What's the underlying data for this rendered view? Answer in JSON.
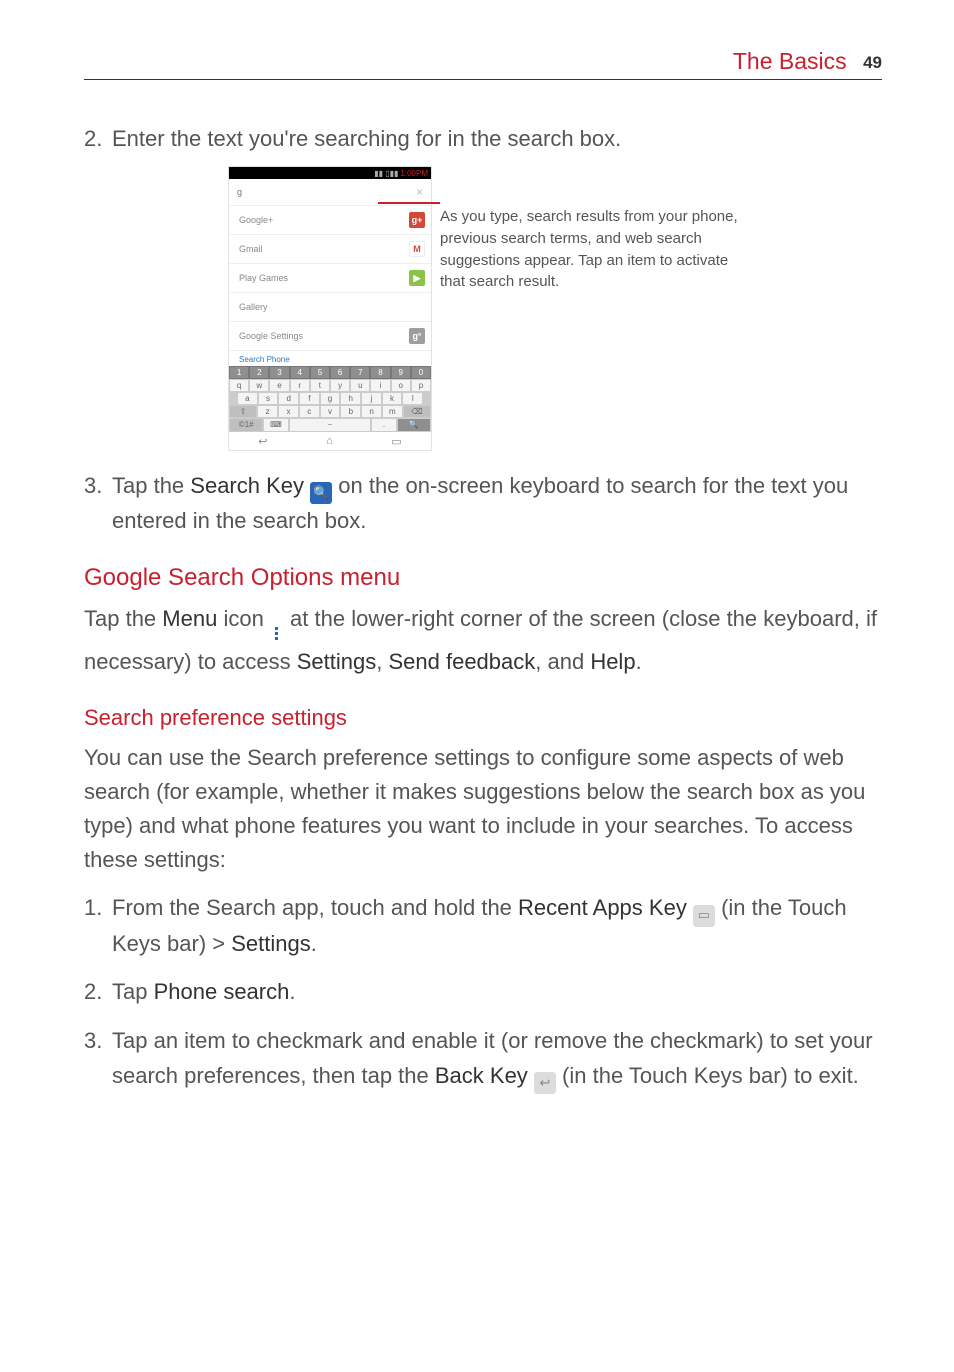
{
  "header": {
    "section": "The Basics",
    "page": "49"
  },
  "step2": {
    "num": "2.",
    "text": "Enter the text you're searching for in the search box."
  },
  "phone": {
    "status_time": "1:00PM",
    "search_value": "g",
    "suggestions": [
      {
        "label": "Google+",
        "icon": "g+"
      },
      {
        "label": "Gmail",
        "icon": "M"
      },
      {
        "label": "Play Games",
        "icon": "▶"
      },
      {
        "label": "Gallery",
        "icon": "◪"
      },
      {
        "label": "Google Settings",
        "icon": "g°"
      }
    ],
    "search_phone_label": "Search Phone",
    "keyboard": {
      "row_nums": [
        "1",
        "2",
        "3",
        "4",
        "5",
        "6",
        "7",
        "8",
        "9",
        "0"
      ],
      "row1": [
        "q",
        "w",
        "e",
        "r",
        "t",
        "y",
        "u",
        "i",
        "o",
        "p"
      ],
      "row2": [
        "a",
        "s",
        "d",
        "f",
        "g",
        "h",
        "j",
        "k",
        "l"
      ],
      "row3_shift": "⇧",
      "row3": [
        "z",
        "x",
        "c",
        "v",
        "b",
        "n",
        "m"
      ],
      "row3_bksp": "⌫",
      "row4_sym": "©1#",
      "row4_kbd": "⌨",
      "row4_dot": ".",
      "row4_search": "🔍"
    },
    "nav": {
      "back": "↩",
      "home": "⌂",
      "recent": "▭"
    }
  },
  "callout": "As you type, search results from your phone, previous search terms, and web search suggestions appear. Tap an item to activate that search result.",
  "step3": {
    "num": "3.",
    "pre": "Tap the ",
    "key": "Search Key",
    "post": " on the on-screen keyboard to search for the text you entered in the search box."
  },
  "h_options": "Google Search Options menu",
  "options_para": {
    "p1": "Tap the ",
    "menu": "Menu",
    "p2": " icon ",
    "p3": " at the lower-right corner of the screen (close the keyboard, if necessary) to access ",
    "s1": "Settings",
    "c1": ", ",
    "s2": "Send feedback",
    "c2": ", and ",
    "s3": "Help",
    "end": "."
  },
  "h_pref": "Search preference settings",
  "pref_para": "You can use the Search preference settings to configure some aspects of web search (for example, whether it makes suggestions below the search box as you type) and what phone features you want to include in your searches. To access these settings:",
  "pref_steps": {
    "s1": {
      "num": "1.",
      "p1": "From the Search app, touch and hold the ",
      "key": "Recent Apps Key",
      "p2": " (in the Touch Keys bar) > ",
      "s": "Settings",
      "end": "."
    },
    "s2": {
      "num": "2.",
      "p1": "Tap ",
      "s": "Phone search",
      "end": "."
    },
    "s3": {
      "num": "3.",
      "p1": "Tap an item to checkmark and enable it (or remove the checkmark) to set your search preferences, then tap the ",
      "key": "Back Key",
      "p2": " (in the Touch Keys bar) to exit."
    }
  }
}
